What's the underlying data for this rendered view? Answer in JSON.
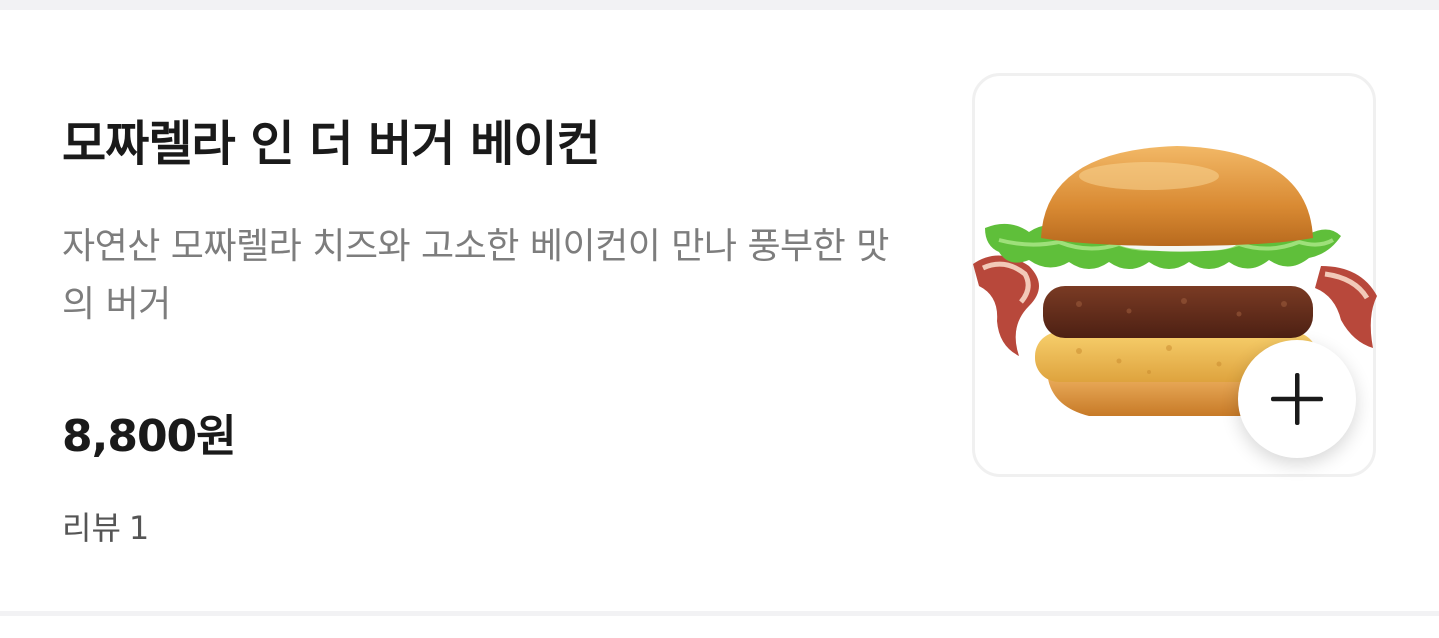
{
  "menu_item": {
    "title": "모짜렐라 인 더 버거 베이컨",
    "description": "자연산 모짜렐라 치즈와 고소한 베이컨이 만나 풍부한 맛의 버거",
    "price": "8,800원",
    "review_label": "리뷰",
    "review_count": "1",
    "image_icon": "burger-image",
    "add_button_icon": "plus-icon"
  },
  "colors": {
    "title": "#1a1a1a",
    "description": "#7d7d7d",
    "review": "#555555",
    "divider": "#f2f2f4",
    "card_border": "#f0f0f0"
  }
}
